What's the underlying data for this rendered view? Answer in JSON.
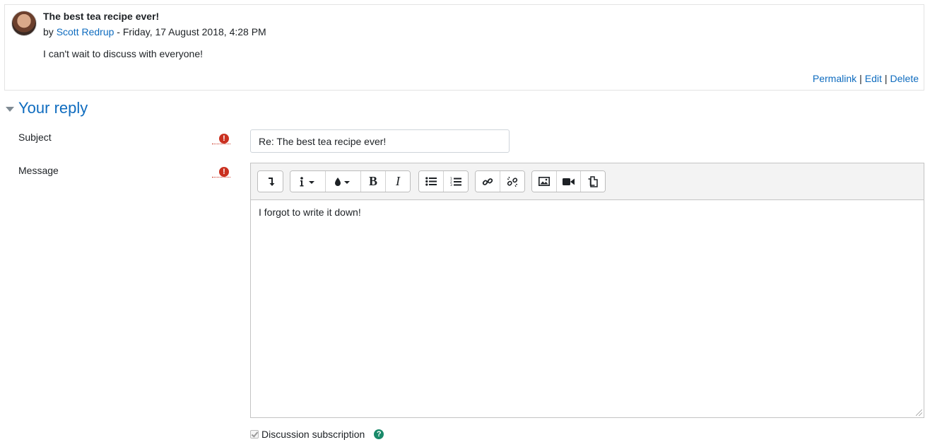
{
  "post": {
    "title": "The best tea recipe ever!",
    "by_prefix": "by",
    "author": "Scott Redrup",
    "date": "- Friday, 17 August 2018, 4:28 PM",
    "body": "I can't wait to discuss with everyone!",
    "actions": {
      "permalink": "Permalink",
      "edit": "Edit",
      "delete": "Delete",
      "separator": "|"
    }
  },
  "reply": {
    "section_title": "Your reply",
    "subject_label": "Subject",
    "subject_value": "Re: The best tea recipe ever!",
    "message_label": "Message",
    "required_icon": "exclamation-circle-icon",
    "message_text": "I forgot to write it down!",
    "toolbar_icons": [
      "show-more-buttons-icon",
      "paragraph-styles-icon",
      "text-color-icon",
      "bold-icon",
      "italic-icon",
      "unordered-list-icon",
      "ordered-list-icon",
      "link-icon",
      "unlink-icon",
      "insert-image-icon",
      "insert-media-icon",
      "manage-files-icon"
    ],
    "subscription_label": "Discussion subscription",
    "subscription_checked": true
  },
  "colors": {
    "link": "#0f6cbf",
    "required": "#ca3120",
    "help": "#1a8a6a"
  }
}
